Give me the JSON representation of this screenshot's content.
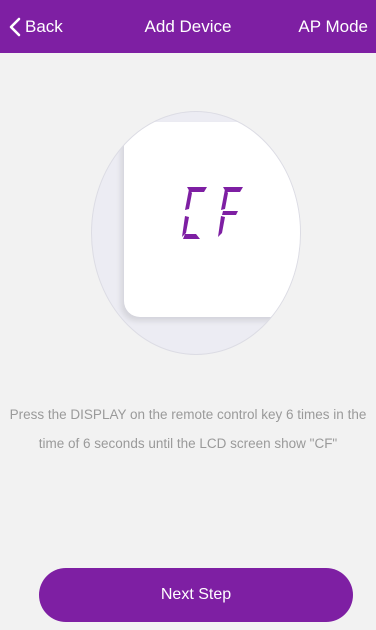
{
  "header": {
    "back_icon": "chevron-left-icon",
    "back_label": "Back",
    "title": "Add Device",
    "ap_mode_label": "AP Mode"
  },
  "display": {
    "lcd_text": "CF",
    "lcd_color": "#7e1fa3"
  },
  "instruction": "Press the DISPLAY on the remote control key 6 times in the time of 6 seconds until the LCD screen show \"CF\"",
  "next_button_label": "Next Step",
  "colors": {
    "accent": "#7e1fa3",
    "background": "#f2f2f2",
    "text_muted": "#9a9a9a"
  }
}
